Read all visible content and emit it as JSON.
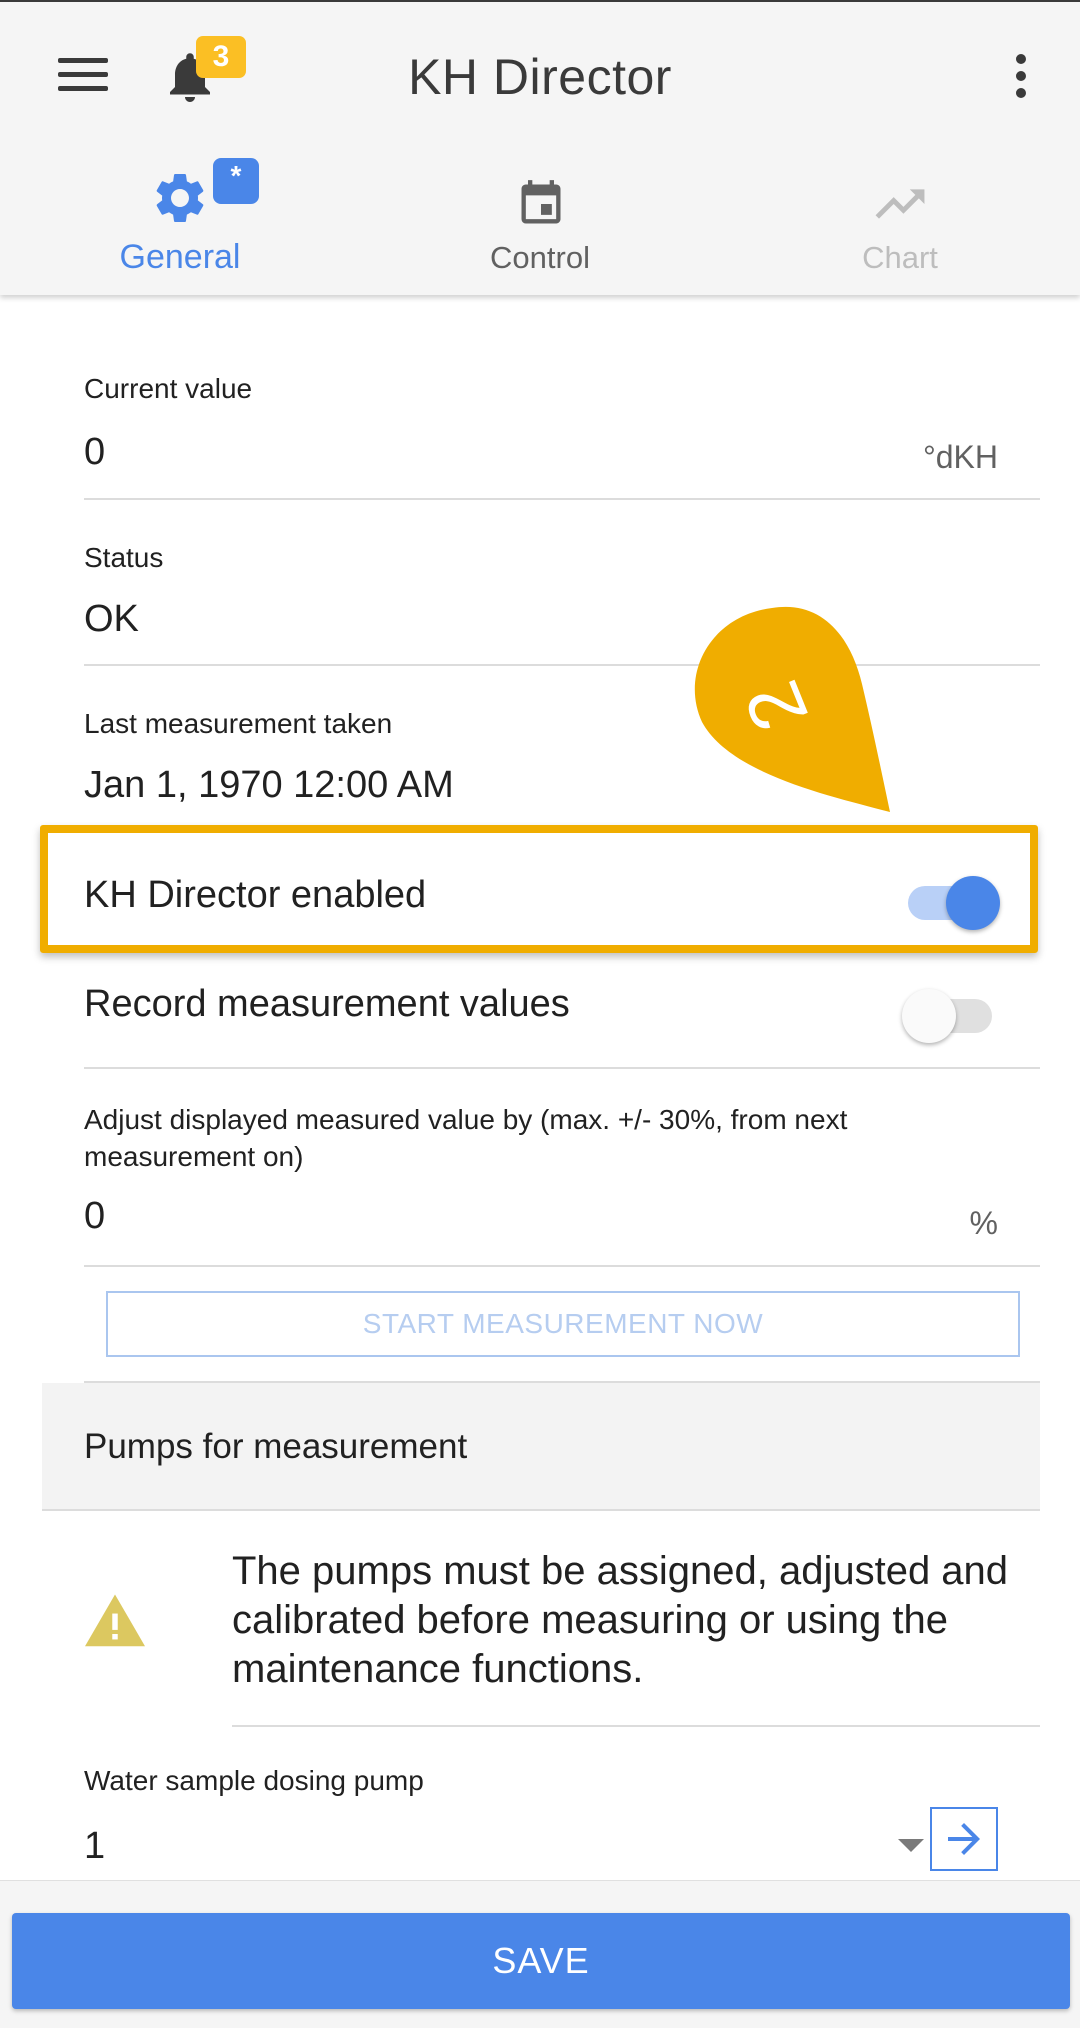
{
  "app": {
    "title": "KH Director",
    "notification_count": "3",
    "unsaved_marker": "*"
  },
  "tabs": [
    {
      "label": "General",
      "icon": "gear-icon",
      "active": true
    },
    {
      "label": "Control",
      "icon": "calendar-icon",
      "active": false
    },
    {
      "label": "Chart",
      "icon": "trending-up-icon",
      "active": false,
      "disabled": true
    }
  ],
  "fields": {
    "current_value": {
      "label": "Current value",
      "value": "0",
      "unit": "°dKH"
    },
    "status": {
      "label": "Status",
      "value": "OK"
    },
    "last_measurement": {
      "label": "Last measurement taken",
      "value": "Jan 1, 1970 12:00 AM"
    },
    "adjust": {
      "label": "Adjust displayed measured value by (max. +/- 30%, from next measurement on)",
      "value": "0",
      "unit": "%"
    },
    "water_sample_pump": {
      "label": "Water sample dosing pump",
      "value": "1"
    }
  },
  "toggles": {
    "kh_enabled": {
      "label": "KH Director enabled",
      "on": true
    },
    "record_values": {
      "label": "Record measurement values",
      "on": false
    }
  },
  "buttons": {
    "start_measurement": "START MEASUREMENT NOW",
    "save": "SAVE"
  },
  "sections": {
    "pumps_header": "Pumps for measurement",
    "pumps_warning": "The pumps must be assigned, adjusted and calibrated before measuring or using the maintenance functions."
  },
  "annotation": {
    "step": "2",
    "color": "#f0ad00"
  },
  "colors": {
    "accent": "#4a86e8",
    "badge": "#fbbf24",
    "warning": "#dcc860"
  }
}
